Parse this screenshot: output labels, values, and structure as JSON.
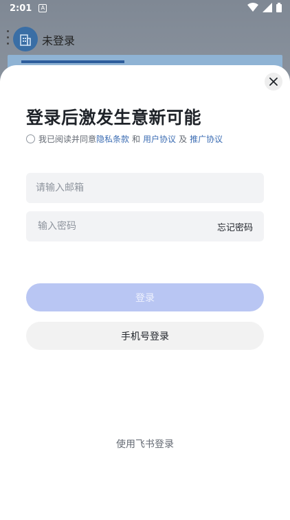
{
  "status_bar": {
    "time": "2:01",
    "app_badge": "A"
  },
  "background": {
    "title": "未登录"
  },
  "sheet": {
    "heading": "登录后激发生意新可能",
    "agreement": {
      "prefix": "我已阅读并同意",
      "privacy_link": "隐私条款",
      "and": "和",
      "user_agreement_link": "用户协议",
      "also": "及",
      "promotion_link": "推广协议"
    },
    "email_field": {
      "placeholder": "请输入邮箱",
      "value": ""
    },
    "password_field": {
      "placeholder": "输入密码",
      "value": "",
      "forgot_label": "忘记密码"
    },
    "login_button": "登录",
    "phone_login_button": "手机号登录",
    "feishu_login": "使用飞书登录"
  },
  "colors": {
    "link": "#3c6db3",
    "login_button_disabled": "#b9c6f3",
    "secondary_button": "#f2f2f2",
    "input_background": "#f2f3f5"
  },
  "icons": [
    "wifi-icon",
    "signal-icon",
    "battery-icon",
    "building-icon",
    "close-icon"
  ]
}
